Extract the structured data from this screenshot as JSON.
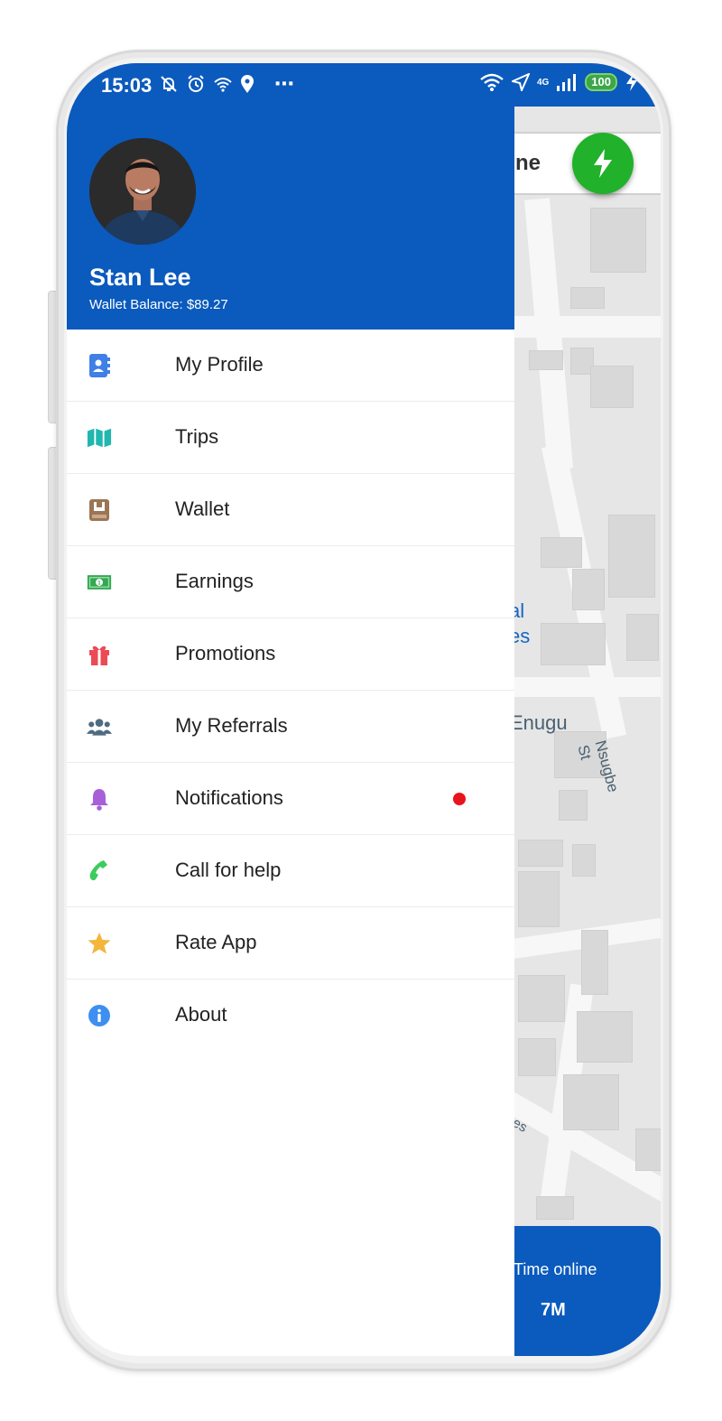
{
  "status_bar": {
    "time": "15:03",
    "network": "4G",
    "battery": "100",
    "more": "⋯"
  },
  "drawer": {
    "user_name": "Stan Lee",
    "wallet_balance": "Wallet Balance: $89.27",
    "menu": [
      {
        "label": "My Profile",
        "icon": "contact-book-icon",
        "color": "#3f7fe6"
      },
      {
        "label": "Trips",
        "icon": "map-icon",
        "color": "#1fb7b0"
      },
      {
        "label": "Wallet",
        "icon": "wallet-icon",
        "color": "#9b7554"
      },
      {
        "label": "Earnings",
        "icon": "money-icon",
        "color": "#34a853"
      },
      {
        "label": "Promotions",
        "icon": "gift-icon",
        "color": "#ec4b55"
      },
      {
        "label": "My Referrals",
        "icon": "users-icon",
        "color": "#4e6b80"
      },
      {
        "label": "Notifications",
        "icon": "bell-icon",
        "color": "#a860d8",
        "has_dot": true
      },
      {
        "label": "Call for help",
        "icon": "phone-icon",
        "color": "#3ccc5e"
      },
      {
        "label": "Rate App",
        "icon": "star-icon",
        "color": "#f3b53b"
      },
      {
        "label": "About",
        "icon": "info-icon",
        "color": "#3d8ff0"
      }
    ]
  },
  "map": {
    "search_text": "ne",
    "label_blue_1": "al",
    "label_blue_2": "es",
    "label_city": "Enugu",
    "label_street": "Nsugbe St",
    "label_partial": "es"
  },
  "online_card": {
    "title": "Time online",
    "value": "7M"
  },
  "colors": {
    "brand_blue": "#0b5abd",
    "go_green": "#21b12a",
    "notification_red": "#e8141c"
  }
}
